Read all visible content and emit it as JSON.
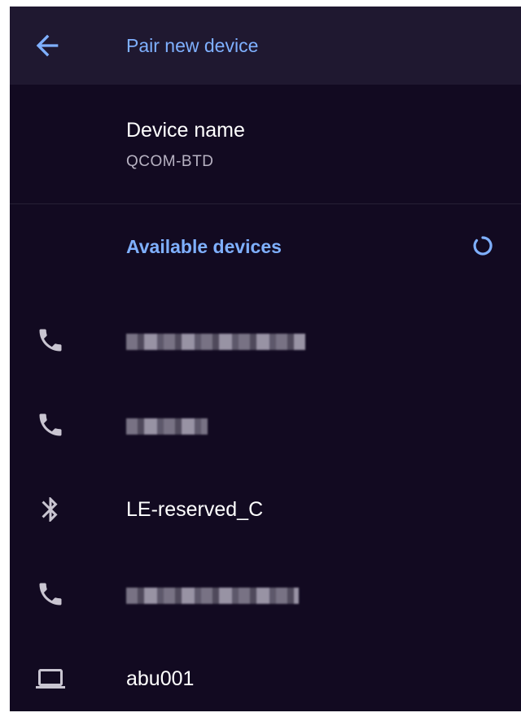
{
  "app_bar": {
    "title": "Pair new device",
    "back_icon": "arrow-left-icon"
  },
  "device_name": {
    "title": "Device name",
    "summary": "QCOM-BTD"
  },
  "available_devices": {
    "title": "Available devices",
    "scanning_indicator": "progress-spinner-icon",
    "items": [
      {
        "icon": "phone-icon",
        "label": ""
      },
      {
        "icon": "phone-icon",
        "label": ""
      },
      {
        "icon": "bluetooth-icon",
        "label": "LE-reserved_C"
      },
      {
        "icon": "phone-icon",
        "label": ""
      },
      {
        "icon": "laptop-icon",
        "label": "abu001"
      }
    ]
  },
  "colors": {
    "background": "#120a21",
    "app_bar": "#1f1830",
    "accent": "#7fb0ff",
    "text_primary": "#ffffff",
    "text_secondary": "#b7b2c2",
    "icon": "#c9c5d1"
  }
}
